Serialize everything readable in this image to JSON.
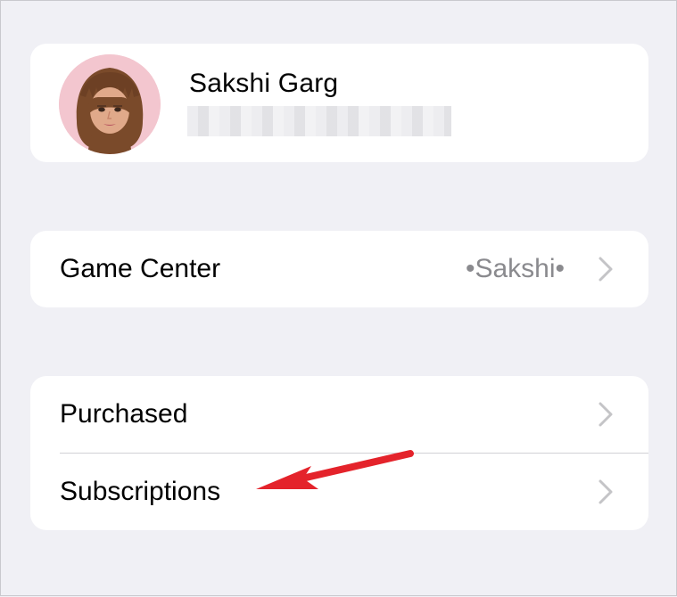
{
  "profile": {
    "name": "Sakshi Garg",
    "email": ""
  },
  "game_center": {
    "label": "Game Center",
    "value": "•Sakshi•"
  },
  "list": {
    "items": [
      {
        "label": "Purchased"
      },
      {
        "label": "Subscriptions"
      }
    ]
  },
  "icons": {
    "chevron": "chevron-right-icon",
    "avatar": "memoji-avatar",
    "annotation": "red-arrow-annotation"
  },
  "colors": {
    "background": "#f0f0f5",
    "card": "#ffffff",
    "secondary_text": "#8a8a8e",
    "chevron": "#c4c4c7",
    "annotation": "#e4232b",
    "avatar_bg": "#f3c6cf"
  }
}
